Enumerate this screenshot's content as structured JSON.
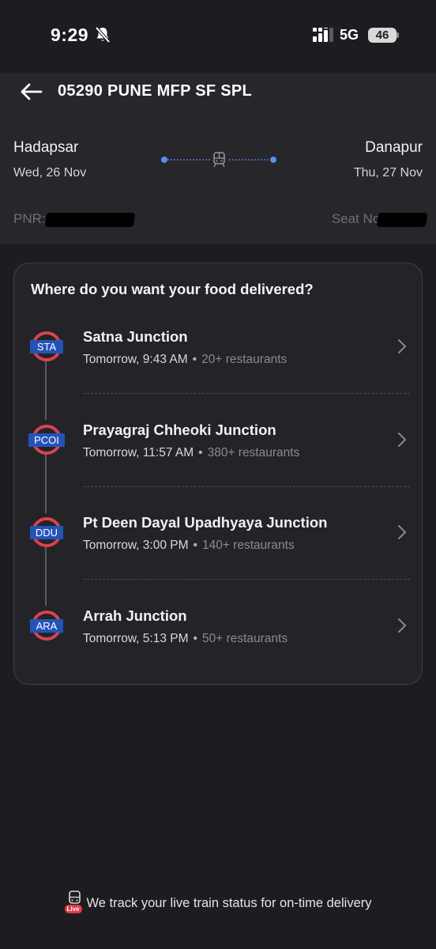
{
  "status_bar": {
    "time": "9:29",
    "network": "5G",
    "battery": "46"
  },
  "header": {
    "title": "05290 PUNE MFP SF SPL",
    "from": {
      "station": "Hadapsar",
      "date": "Wed, 26 Nov"
    },
    "to": {
      "station": "Danapur",
      "date": "Thu, 27 Nov"
    },
    "pnr_label": "PNR:",
    "seat_label": "Seat No:"
  },
  "card": {
    "title": "Where do you want your food delivered?",
    "stops": [
      {
        "code": "STA",
        "name": "Satna Junction",
        "time": "Tomorrow, 9:43 AM",
        "restaurants": "20+ restaurants"
      },
      {
        "code": "PCOI",
        "name": "Prayagraj Chheoki Junction",
        "time": "Tomorrow, 11:57 AM",
        "restaurants": "380+ restaurants"
      },
      {
        "code": "DDU",
        "name": "Pt Deen Dayal Upadhyaya Junction",
        "time": "Tomorrow, 3:00 PM",
        "restaurants": "140+ restaurants"
      },
      {
        "code": "ARA",
        "name": "Arrah Junction",
        "time": "Tomorrow, 5:13 PM",
        "restaurants": "50+ restaurants"
      }
    ]
  },
  "footer": {
    "live_badge": "Live",
    "text": "We track your live train status for on-time delivery"
  },
  "colors": {
    "background": "#1c1c21",
    "header_bg": "#26262b",
    "roundel_red": "#d9434e",
    "code_blue": "#2453b8",
    "route_dot": "#5b8def"
  }
}
